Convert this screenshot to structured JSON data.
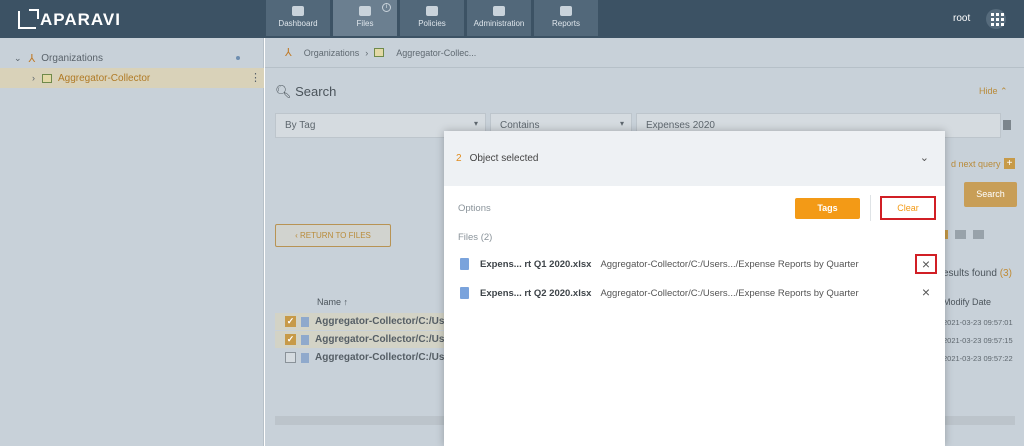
{
  "app": {
    "logo": "APARAVI",
    "user": "root"
  },
  "nav": [
    {
      "label": "Dashboard",
      "icon": "dashboard-icon"
    },
    {
      "label": "Files",
      "icon": "folder-icon",
      "badge": "i"
    },
    {
      "label": "Policies",
      "icon": "gear-icon"
    },
    {
      "label": "Administration",
      "icon": "users-icon"
    },
    {
      "label": "Reports",
      "icon": "clipboard-icon"
    }
  ],
  "sidebar": {
    "org": "Organizations",
    "collector": "Aggregator-Collector"
  },
  "breadcrumb": {
    "org": "Organizations",
    "sep": "›",
    "collector": "Aggregator-Collec..."
  },
  "search": {
    "title": "Search",
    "hide": "Hide",
    "by": "By Tag",
    "op": "Contains",
    "value": "Expenses 2020",
    "next_query": "d next query",
    "button": "Search"
  },
  "results": {
    "return": "RETURN TO FILES",
    "found": "esults found",
    "count": "(3)",
    "name_col": "Name ↑",
    "modify_col": "Modify Date",
    "rows": [
      {
        "name": "Aggregator-Collector/C:/Use",
        "date": "2021-03-23 09:57:01",
        "checked": true
      },
      {
        "name": "Aggregator-Collector/C:/Use",
        "date": "2021-03-23 09:57:15",
        "checked": true
      },
      {
        "name": "Aggregator-Collector/C:/Use",
        "date": "2021-03-23 09:57:22",
        "checked": false
      }
    ]
  },
  "modal": {
    "count": "2",
    "title": "Object selected",
    "options": "Options",
    "tags": "Tags",
    "clear": "Clear",
    "files_label": "Files (2)",
    "files": [
      {
        "name": "Expens... rt Q1 2020.xlsx",
        "path": "Aggregator-Collector/C:/Users.../Expense Reports by Quarter"
      },
      {
        "name": "Expens... rt Q2 2020.xlsx",
        "path": "Aggregator-Collector/C:/Users.../Expense Reports by Quarter"
      }
    ],
    "remove": "×"
  },
  "colors": {
    "accent": "#f39a16",
    "highlight": "#d11f25",
    "topbar": "#3c5264"
  }
}
